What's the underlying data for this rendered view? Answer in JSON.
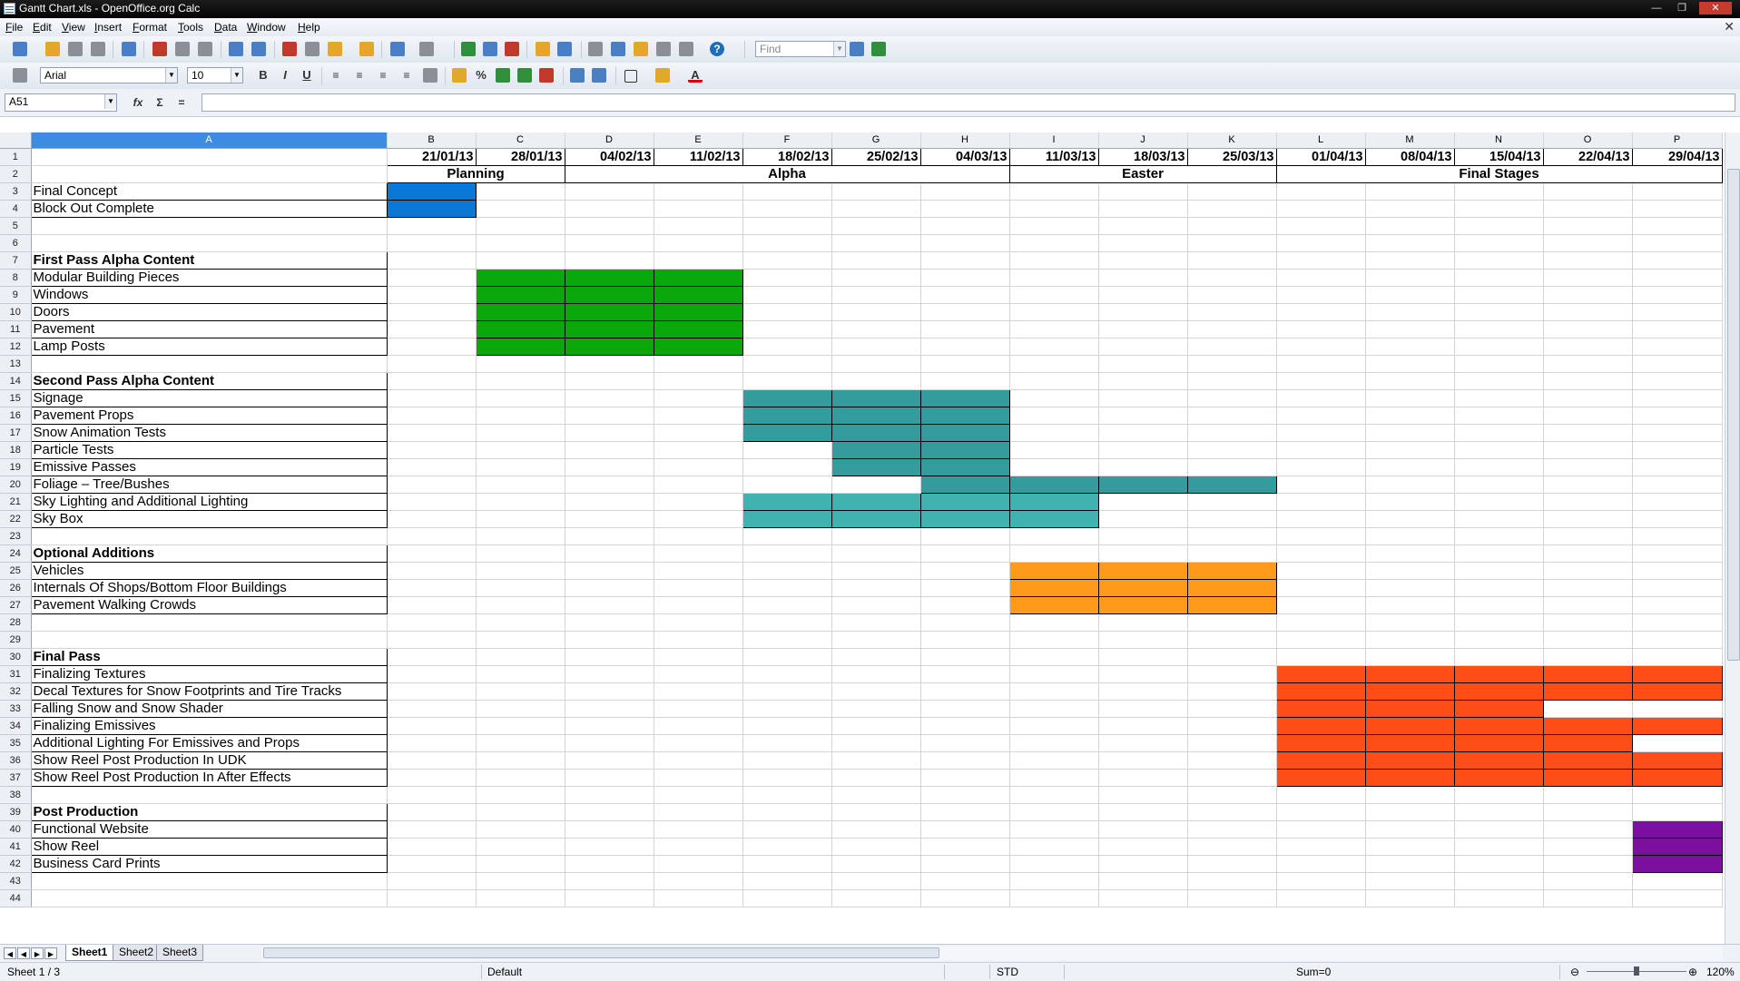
{
  "window": {
    "title": "Gantt Chart.xls - OpenOffice.org Calc"
  },
  "menu": [
    "File",
    "Edit",
    "View",
    "Insert",
    "Format",
    "Tools",
    "Data",
    "Window",
    "Help"
  ],
  "toolbar": {
    "find_placeholder": "Find",
    "font_name": "Arial",
    "font_size": "10"
  },
  "formula": {
    "cell_ref": "A51",
    "content": ""
  },
  "columns": [
    "A",
    "B",
    "C",
    "D",
    "E",
    "F",
    "G",
    "H",
    "I",
    "J",
    "K",
    "L",
    "M",
    "N",
    "O",
    "P"
  ],
  "dates": [
    "21/01/13",
    "28/01/13",
    "04/02/13",
    "11/02/13",
    "18/02/13",
    "25/02/13",
    "04/03/13",
    "11/03/13",
    "18/03/13",
    "25/03/13",
    "01/04/13",
    "08/04/13",
    "15/04/13",
    "22/04/13",
    "29/04/13"
  ],
  "phases": [
    {
      "label": "Planning",
      "start": 0,
      "span": 2
    },
    {
      "label": "Alpha",
      "start": 2,
      "span": 5
    },
    {
      "label": "Easter",
      "start": 7,
      "span": 3
    },
    {
      "label": "Final Stages",
      "start": 10,
      "span": 5
    }
  ],
  "colors": {
    "blue": "#0a78d7",
    "green": "#0ba80b",
    "teal": "#339c9c",
    "light_teal": "#40b2b0",
    "orange": "#ff9a1a",
    "red": "#ff4d18",
    "purple": "#7a0fa0",
    "selection": "#3a8de0"
  },
  "tasks": [
    {
      "row": 3,
      "label": "Final Concept",
      "bold": false,
      "color": "blue",
      "cells": [
        0
      ]
    },
    {
      "row": 4,
      "label": "Block Out Complete",
      "bold": false,
      "color": null,
      "cells": []
    },
    {
      "row": 5,
      "label": null
    },
    {
      "row": 6,
      "label": null
    },
    {
      "row": 7,
      "label": "First Pass Alpha Content",
      "bold": true,
      "color": null,
      "cells": []
    },
    {
      "row": 8,
      "label": "Modular Building Pieces",
      "bold": false,
      "color": "green",
      "cells": [
        1,
        2,
        3
      ]
    },
    {
      "row": 9,
      "label": "Windows",
      "bold": false,
      "color": "green",
      "cells": [
        1,
        2,
        3
      ]
    },
    {
      "row": 10,
      "label": "Doors",
      "bold": false,
      "color": "green",
      "cells": [
        1,
        2,
        3
      ]
    },
    {
      "row": 11,
      "label": "Pavement",
      "bold": false,
      "color": "green",
      "cells": [
        1,
        2,
        3
      ]
    },
    {
      "row": 12,
      "label": "Lamp Posts",
      "bold": false,
      "color": "green",
      "cells": [
        1,
        2,
        3
      ]
    },
    {
      "row": 13,
      "label": null
    },
    {
      "row": 14,
      "label": "Second Pass Alpha Content",
      "bold": true,
      "color": null,
      "cells": []
    },
    {
      "row": 15,
      "label": "Signage",
      "bold": false,
      "color": "teal",
      "cells": [
        4,
        5,
        6
      ]
    },
    {
      "row": 16,
      "label": "Pavement Props",
      "bold": false,
      "color": "teal",
      "cells": [
        4,
        5,
        6
      ]
    },
    {
      "row": 17,
      "label": "Snow Animation Tests",
      "bold": false,
      "color": "teal",
      "cells": [
        4,
        5,
        6
      ]
    },
    {
      "row": 18,
      "label": "Particle Tests",
      "bold": false,
      "color": "teal",
      "cells": [
        5,
        6
      ]
    },
    {
      "row": 19,
      "label": "Emissive Passes",
      "bold": false,
      "color": "teal",
      "cells": [
        5,
        6
      ]
    },
    {
      "row": 20,
      "label": "Foliage – Tree/Bushes",
      "bold": false,
      "color": "teal",
      "cells": [
        6,
        7,
        8,
        9
      ]
    },
    {
      "row": 21,
      "label": "Sky Lighting and Additional Lighting",
      "bold": false,
      "color": "light_teal",
      "cells": [
        4,
        5,
        6,
        7
      ]
    },
    {
      "row": 22,
      "label": "Sky Box",
      "bold": false,
      "color": "light_teal",
      "cells": [
        4,
        5,
        6,
        7
      ]
    },
    {
      "row": 23,
      "label": null
    },
    {
      "row": 24,
      "label": "Optional Additions",
      "bold": true,
      "color": null,
      "cells": []
    },
    {
      "row": 25,
      "label": "Vehicles",
      "bold": false,
      "color": "orange",
      "cells": [
        7,
        8,
        9
      ]
    },
    {
      "row": 26,
      "label": "Internals Of Shops/Bottom Floor Buildings",
      "bold": false,
      "color": "orange",
      "cells": [
        7,
        8,
        9
      ]
    },
    {
      "row": 27,
      "label": "Pavement Walking Crowds",
      "bold": false,
      "color": "orange",
      "cells": [
        7,
        8,
        9
      ]
    },
    {
      "row": 28,
      "label": null
    },
    {
      "row": 29,
      "label": null
    },
    {
      "row": 30,
      "label": "Final Pass",
      "bold": true,
      "color": null,
      "cells": []
    },
    {
      "row": 31,
      "label": "Finalizing Textures",
      "bold": false,
      "color": "red",
      "cells": [
        10,
        11,
        12,
        13,
        14
      ]
    },
    {
      "row": 32,
      "label": "Decal Textures for Snow Footprints and Tire Tracks",
      "bold": false,
      "color": "red",
      "cells": [
        10,
        11,
        12,
        13,
        14
      ]
    },
    {
      "row": 33,
      "label": "Falling Snow and Snow Shader",
      "bold": false,
      "color": "red",
      "cells": [
        10,
        11,
        12
      ]
    },
    {
      "row": 34,
      "label": "Finalizing Emissives",
      "bold": false,
      "color": "red",
      "cells": [
        10,
        11,
        12,
        13,
        14
      ]
    },
    {
      "row": 35,
      "label": "Additional Lighting For Emissives and Props",
      "bold": false,
      "color": "red",
      "cells": [
        10,
        11,
        12,
        13
      ]
    },
    {
      "row": 36,
      "label": "Show Reel Post Production In UDK",
      "bold": false,
      "color": "red",
      "cells": [
        10,
        11,
        12,
        13,
        14
      ]
    },
    {
      "row": 37,
      "label": "Show Reel Post Production In After Effects",
      "bold": false,
      "color": "red",
      "cells": [
        10,
        11,
        12,
        13,
        14
      ]
    },
    {
      "row": 38,
      "label": null
    },
    {
      "row": 39,
      "label": "Post Production",
      "bold": true,
      "color": null,
      "cells": []
    },
    {
      "row": 40,
      "label": "Functional Website",
      "bold": false,
      "color": "purple",
      "cells": [
        14
      ]
    },
    {
      "row": 41,
      "label": "Show Reel",
      "bold": false,
      "color": "purple",
      "cells": [
        14
      ]
    },
    {
      "row": 42,
      "label": "Business Card Prints",
      "bold": false,
      "color": "purple",
      "cells": [
        14
      ]
    },
    {
      "row": 43,
      "label": null
    },
    {
      "row": 44,
      "label": null
    }
  ],
  "sheets": [
    "Sheet1",
    "Sheet2",
    "Sheet3"
  ],
  "active_sheet": "Sheet1",
  "status": {
    "sheet_info": "Sheet 1 / 3",
    "page_style": "Default",
    "mode": "STD",
    "sum": "Sum=0",
    "zoom": "120%"
  }
}
